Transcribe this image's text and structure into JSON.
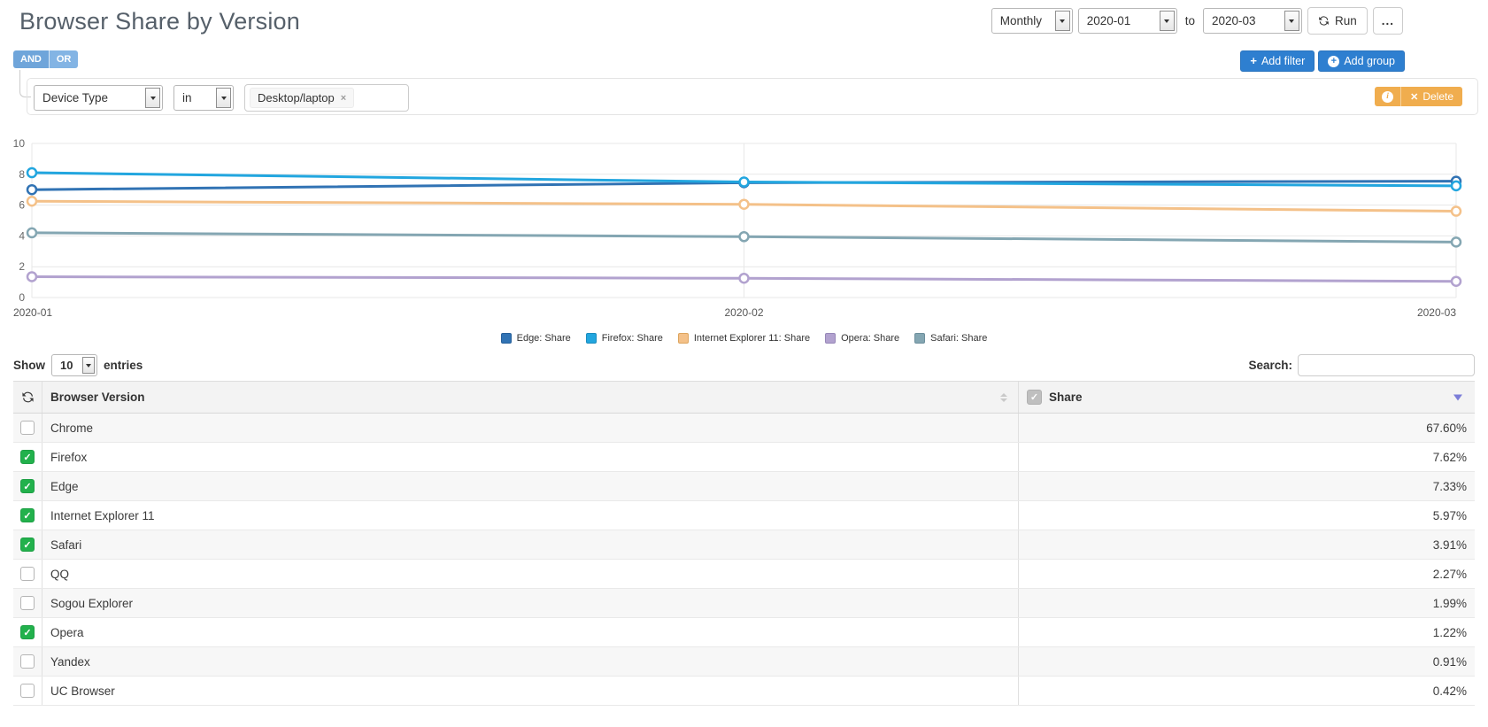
{
  "header": {
    "title": "Browser Share by Version",
    "granularity": "Monthly",
    "date_from": "2020-01",
    "to_label": "to",
    "date_to": "2020-03",
    "run_label": "Run",
    "more_label": "..."
  },
  "filter_bar": {
    "and_label": "AND",
    "or_label": "OR",
    "plus_icon": "+",
    "add_filter_label": "Add filter",
    "add_group_label": "Add group"
  },
  "filter_row": {
    "field": "Device Type",
    "operator": "in",
    "value": "Desktop/laptop",
    "remove_icon": "×",
    "info_icon": "i",
    "delete_icon": "✕",
    "delete_label": "Delete"
  },
  "chart_data": {
    "type": "line",
    "x": [
      "2020-01",
      "2020-02",
      "2020-03"
    ],
    "ylim": [
      0,
      10
    ],
    "yticks": [
      0,
      2,
      4,
      6,
      8,
      10
    ],
    "grid": true,
    "legend_position": "bottom",
    "series": [
      {
        "name": "Edge: Share",
        "color": "#3173b4",
        "border": "#27609a",
        "values": [
          7.0,
          7.45,
          7.55
        ]
      },
      {
        "name": "Firefox: Share",
        "color": "#22a6df",
        "border": "#1b8cbe",
        "values": [
          8.1,
          7.5,
          7.25
        ]
      },
      {
        "name": "Internet Explorer 11: Share",
        "color": "#f4c189",
        "border": "#dda55e",
        "values": [
          6.25,
          6.05,
          5.6
        ]
      },
      {
        "name": "Opera: Share",
        "color": "#b2a2cf",
        "border": "#9787b8",
        "values": [
          1.35,
          1.25,
          1.05
        ]
      },
      {
        "name": "Safari: Share",
        "color": "#84a6b2",
        "border": "#6d8f9c",
        "values": [
          4.2,
          3.95,
          3.6
        ]
      }
    ]
  },
  "table_controls": {
    "show_label": "Show",
    "page_size": "10",
    "entries_label": "entries",
    "search_label": "Search:",
    "search_value": ""
  },
  "table": {
    "columns": [
      "Browser Version",
      "Share"
    ],
    "check_glyph": "✓",
    "rows": [
      {
        "name": "Chrome",
        "share": "67.60%",
        "checked": false
      },
      {
        "name": "Firefox",
        "share": "7.62%",
        "checked": true
      },
      {
        "name": "Edge",
        "share": "7.33%",
        "checked": true
      },
      {
        "name": "Internet Explorer 11",
        "share": "5.97%",
        "checked": true
      },
      {
        "name": "Safari",
        "share": "3.91%",
        "checked": true
      },
      {
        "name": "QQ",
        "share": "2.27%",
        "checked": false
      },
      {
        "name": "Sogou Explorer",
        "share": "1.99%",
        "checked": false
      },
      {
        "name": "Opera",
        "share": "1.22%",
        "checked": true
      },
      {
        "name": "Yandex",
        "share": "0.91%",
        "checked": false
      },
      {
        "name": "UC Browser",
        "share": "0.42%",
        "checked": false
      }
    ]
  }
}
